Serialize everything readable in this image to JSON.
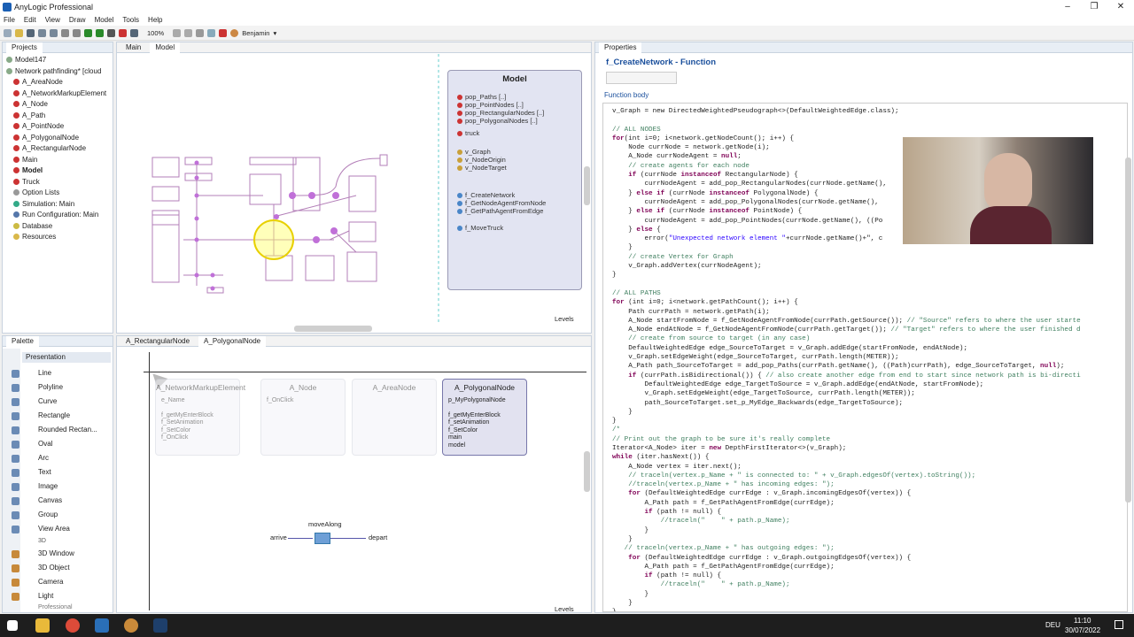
{
  "window": {
    "title": "AnyLogic Professional"
  },
  "menu": [
    "File",
    "Edit",
    "View",
    "Draw",
    "Model",
    "Tools",
    "Help"
  ],
  "toolbar": {
    "zoom": "100%",
    "user": "Benjamin"
  },
  "projects": {
    "tab": "Projects",
    "items": [
      {
        "label": "Model147",
        "level": 0,
        "icon": "model-icon"
      },
      {
        "label": "Network pathfinding* [cloud",
        "level": 0,
        "icon": "model-icon"
      },
      {
        "label": "A_AreaNode",
        "level": 1,
        "icon": "agent-icon"
      },
      {
        "label": "A_NetworkMarkupElement",
        "level": 1,
        "icon": "agent-icon"
      },
      {
        "label": "A_Node",
        "level": 1,
        "icon": "agent-icon"
      },
      {
        "label": "A_Path",
        "level": 1,
        "icon": "agent-icon"
      },
      {
        "label": "A_PointNode",
        "level": 1,
        "icon": "agent-icon"
      },
      {
        "label": "A_PolygonalNode",
        "level": 1,
        "icon": "agent-icon"
      },
      {
        "label": "A_RectangularNode",
        "level": 1,
        "icon": "agent-icon"
      },
      {
        "label": "Main",
        "level": 1,
        "icon": "agent-icon"
      },
      {
        "label": "Model",
        "level": 1,
        "icon": "agent-icon",
        "bold": true
      },
      {
        "label": "Truck",
        "level": 1,
        "icon": "agent-icon"
      },
      {
        "label": "Option Lists",
        "level": 1,
        "icon": "list-icon"
      },
      {
        "label": "Simulation: Main",
        "level": 1,
        "icon": "simulation-icon"
      },
      {
        "label": "Run Configuration: Main",
        "level": 1,
        "icon": "run-icon"
      },
      {
        "label": "Database",
        "level": 1,
        "icon": "database-icon"
      },
      {
        "label": "Resources",
        "level": 1,
        "icon": "folder-icon"
      }
    ]
  },
  "palette": {
    "tab": "Palette",
    "section": "Presentation",
    "items": [
      "Line",
      "Polyline",
      "Curve",
      "Rectangle",
      "Rounded Rectan...",
      "Oval",
      "Arc",
      "Text",
      "Image",
      "Canvas",
      "Group",
      "View Area"
    ],
    "section3d": "3D",
    "items3d": [
      "3D Window",
      "3D Object",
      "Camera",
      "Light"
    ],
    "footer": "Professional"
  },
  "editor_top": {
    "tabs": [
      "Main",
      "Model"
    ],
    "levels": "Levels",
    "model_card": {
      "title": "Model",
      "pops": [
        "pop_Paths [..]",
        "pop_PointNodes [..]",
        "pop_RectangularNodes [..]",
        "pop_PolygonalNodes [..]"
      ],
      "truck": "truck",
      "vars": [
        "v_Graph",
        "v_NodeOrigin",
        "v_NodeTarget"
      ],
      "funcs": [
        "f_CreateNetwork",
        "f_GetNodeAgentFromNode",
        "f_GetPathAgentFromEdge"
      ],
      "move": "f_MoveTruck"
    }
  },
  "editor_bottom": {
    "tabs": [
      "A_RectangularNode",
      "A_PolygonalNode"
    ],
    "levels": "Levels",
    "cards": [
      {
        "title": "A_NetworkMarkupElement",
        "lines": [
          "e_Name"
        ],
        "funcs": [
          "f_getMyEnterBlock",
          "f_SetAnimation",
          "f_SetColor",
          "f_OnClick"
        ]
      },
      {
        "title": "A_Node",
        "lines": [
          "f_OnClick"
        ],
        "funcs": []
      },
      {
        "title": "A_AreaNode",
        "lines": [],
        "funcs": []
      },
      {
        "title": "A_PolygonalNode",
        "lines": [
          "p_MyPolygonalNode"
        ],
        "funcs": [
          "f_getMyEnterBlock",
          "f_setAnimation",
          "f_SetColor"
        ],
        "extra": [
          "main",
          "model"
        ]
      }
    ],
    "flow": {
      "block": "moveAlong",
      "in": "arrive",
      "out": "depart"
    }
  },
  "properties": {
    "tab": "Properties",
    "title": "f_CreateNetwork - Function",
    "section": "Function body"
  },
  "code": [
    [
      [
        "",
        "v_Graph = new DirectedWeightedPseudograph<>(DefaultWeightedEdge.class);"
      ]
    ],
    [],
    [
      [
        "cm",
        "// ALL NODES"
      ]
    ],
    [
      [
        "kw",
        "for"
      ],
      [
        "",
        "(int i=0; i<network.getNodeCount(); i++) {"
      ]
    ],
    [
      [
        "",
        "    Node currNode = network.getNode(i);"
      ]
    ],
    [
      [
        "",
        "    A_Node currNodeAgent = "
      ],
      [
        "kw",
        "null"
      ],
      [
        "",
        ";"
      ]
    ],
    [
      [
        "cm",
        "    // create agents for each node"
      ]
    ],
    [
      [
        "",
        "    "
      ],
      [
        "kw",
        "if"
      ],
      [
        "",
        " (currNode "
      ],
      [
        "kw",
        "instanceof"
      ],
      [
        "",
        " RectangularNode) {"
      ]
    ],
    [
      [
        "",
        "        currNodeAgent = add_pop_RectangularNodes(currNode.getName(),"
      ]
    ],
    [
      [
        "",
        "    } "
      ],
      [
        "kw",
        "else if"
      ],
      [
        "",
        " (currNode "
      ],
      [
        "kw",
        "instanceof"
      ],
      [
        "",
        " PolygonalNode) {"
      ]
    ],
    [
      [
        "",
        "        currNodeAgent = add_pop_PolygonalNodes(currNode.getName(),"
      ]
    ],
    [
      [
        "",
        "    } "
      ],
      [
        "kw",
        "else if"
      ],
      [
        "",
        " (currNode "
      ],
      [
        "kw",
        "instanceof"
      ],
      [
        "",
        " PointNode) {"
      ]
    ],
    [
      [
        "",
        "        currNodeAgent = add_pop_PointNodes(currNode.getName(), ((Po"
      ]
    ],
    [
      [
        "",
        "    } "
      ],
      [
        "kw",
        "else"
      ],
      [
        "",
        " {"
      ]
    ],
    [
      [
        "",
        "        error("
      ],
      [
        "st",
        "\"Unexpected network element \""
      ],
      [
        "",
        "+currNode.getName()+\", c"
      ]
    ],
    [
      [
        "",
        "    }"
      ]
    ],
    [
      [
        "cm",
        "    // create Vertex for Graph"
      ]
    ],
    [
      [
        "",
        "    v_Graph.addVertex(currNodeAgent);"
      ]
    ],
    [
      [
        "",
        "}"
      ]
    ],
    [],
    [
      [
        "cm",
        "// ALL PATHS"
      ]
    ],
    [
      [
        "kw",
        "for"
      ],
      [
        "",
        " (int i=0; i<network.getPathCount(); i++) {"
      ]
    ],
    [
      [
        "",
        "    Path currPath = network.getPath(i);"
      ]
    ],
    [
      [
        "",
        "    A_Node startFromNode = f_GetNodeAgentFromNode(currPath.getSource()); "
      ],
      [
        "cm",
        "// \"Source\" refers to where the user starte"
      ]
    ],
    [
      [
        "",
        "    A_Node endAtNode = f_GetNodeAgentFromNode(currPath.getTarget()); "
      ],
      [
        "cm",
        "// \"Target\" refers to where the user finished d"
      ]
    ],
    [
      [
        "cm",
        "    // create from source to target (in any case)"
      ]
    ],
    [
      [
        "",
        "    DefaultWeightedEdge edge_SourceToTarget = v_Graph.addEdge(startFromNode, endAtNode);"
      ]
    ],
    [
      [
        "",
        "    v_Graph.setEdgeWeight(edge_SourceToTarget, currPath.length(METER));"
      ]
    ],
    [
      [
        "",
        "    A_Path path_SourceToTarget = add_pop_Paths(currPath.getName(), ((Path)currPath), edge_SourceToTarget, "
      ],
      [
        "kw",
        "null"
      ],
      [
        "",
        ");"
      ]
    ],
    [
      [
        "",
        "    "
      ],
      [
        "kw",
        "if"
      ],
      [
        "",
        " (currPath.isBidirectional()) { "
      ],
      [
        "cm",
        "// also create another edge from end to start since network path is bi-directi"
      ]
    ],
    [
      [
        "",
        "        DefaultWeightedEdge edge_TargetToSource = v_Graph.addEdge(endAtNode, startFromNode);"
      ]
    ],
    [
      [
        "",
        "        v_Graph.setEdgeWeight(edge_TargetToSource, currPath.length(METER));"
      ]
    ],
    [
      [
        "",
        "        path_SourceToTarget.set_p_MyEdge_Backwards(edge_TargetToSource);"
      ]
    ],
    [
      [
        "",
        "    }"
      ]
    ],
    [
      [
        "",
        "}"
      ]
    ],
    [
      [
        "cm",
        "/*"
      ]
    ],
    [
      [
        "cm",
        "// Print out the graph to be sure it's really complete"
      ]
    ],
    [
      [
        "",
        "Iterator<A_Node> iter = "
      ],
      [
        "kw",
        "new"
      ],
      [
        "",
        " DepthFirstIterator<>(v_Graph);"
      ]
    ],
    [
      [
        "kw",
        "while"
      ],
      [
        "",
        " (iter.hasNext()) {"
      ]
    ],
    [
      [
        "",
        "    A_Node vertex = iter.next();"
      ]
    ],
    [
      [
        "cm",
        "    // traceln(vertex.p_Name + \" is connected to: \" + v_Graph.edgesOf(vertex).toString());"
      ]
    ],
    [
      [
        "cm",
        "    //traceln(vertex.p_Name + \" has incoming edges: \");"
      ]
    ],
    [
      [
        "",
        "    "
      ],
      [
        "kw",
        "for"
      ],
      [
        "",
        " (DefaultWeightedEdge currEdge : v_Graph.incomingEdgesOf(vertex)) {"
      ]
    ],
    [
      [
        "",
        "        A_Path path = f_GetPathAgentFromEdge(currEdge);"
      ]
    ],
    [
      [
        "",
        "        "
      ],
      [
        "kw",
        "if"
      ],
      [
        "",
        " (path != null) {"
      ]
    ],
    [
      [
        "cm",
        "            //traceln(\"    \" + path.p_Name);"
      ]
    ],
    [
      [
        "",
        "        }"
      ]
    ],
    [
      [
        "",
        "    }"
      ]
    ],
    [
      [
        "cm",
        "   // traceln(vertex.p_Name + \" has outgoing edges: \");"
      ]
    ],
    [
      [
        "",
        "    "
      ],
      [
        "kw",
        "for"
      ],
      [
        "",
        " (DefaultWeightedEdge currEdge : v_Graph.outgoingEdgesOf(vertex)) {"
      ]
    ],
    [
      [
        "",
        "        A_Path path = f_GetPathAgentFromEdge(currEdge);"
      ]
    ],
    [
      [
        "",
        "        "
      ],
      [
        "kw",
        "if"
      ],
      [
        "",
        " (path != null) {"
      ]
    ],
    [
      [
        "cm",
        "            //traceln(\"    \" + path.p_Name);"
      ]
    ],
    [
      [
        "",
        "        }"
      ]
    ],
    [
      [
        "",
        "    }"
      ]
    ],
    [
      [
        "",
        "}"
      ]
    ]
  ],
  "taskbar": {
    "lang": "DEU",
    "time": "11:10",
    "date": "30/07/2022"
  },
  "colors": {
    "accent": "#1a5fb4",
    "path": "#b37fb8",
    "node": "#c070d8"
  }
}
